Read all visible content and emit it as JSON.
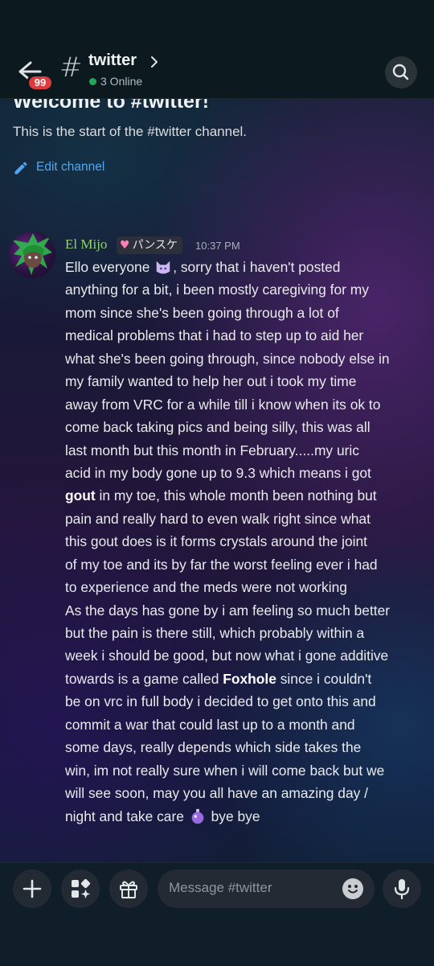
{
  "header": {
    "unread_badge": "99",
    "channel_name": "twitter",
    "online_status": "3 Online"
  },
  "intro": {
    "welcome": "Welcome to #twitter!",
    "start_text": "This is the start of the #twitter channel.",
    "edit_label": "Edit channel"
  },
  "message": {
    "author": "El Mijo",
    "tag": "パンスケ",
    "time": "10:37 PM",
    "lines": [
      [
        "Ello everyone ",
        ", sorry that i haven't posted"
      ],
      "anything for a bit, i been mostly caregiving for my",
      "mom since she's been going through a lot of",
      "medical problems that i had to step up to aid her",
      "what she's been going through, since nobody else in",
      "my family wanted to help her out i took my time",
      "away from VRC for a while till i know when its ok to",
      "come back taking pics and being silly, this was all",
      "last month but this month in February.....my uric",
      "acid in my body gone up to 9.3 which means i got",
      [
        "gout",
        " in my toe, this whole month been nothing but"
      ],
      "pain and really hard to even walk right since what",
      "this gout does is it forms crystals around the joint",
      "of my toe and its by far the worst feeling ever i had",
      "to experience and the meds were not working",
      "As the days has gone by i am feeling so much better",
      "but the pain is there still, which probably within a",
      "week i should be good, but now what i gone additive",
      [
        "towards is a game called ",
        "Foxhole",
        "  since i couldn't"
      ],
      "be on vrc in full body i decided to get onto this and",
      "commit a war that could last up to a month and",
      "some days, really depends which side takes the",
      "win, im not really sure when i will come back but we",
      "will see soon, may you all have an amazing day /",
      [
        "night and take care ",
        " bye bye"
      ]
    ]
  },
  "composer": {
    "placeholder": "Message #twitter"
  }
}
